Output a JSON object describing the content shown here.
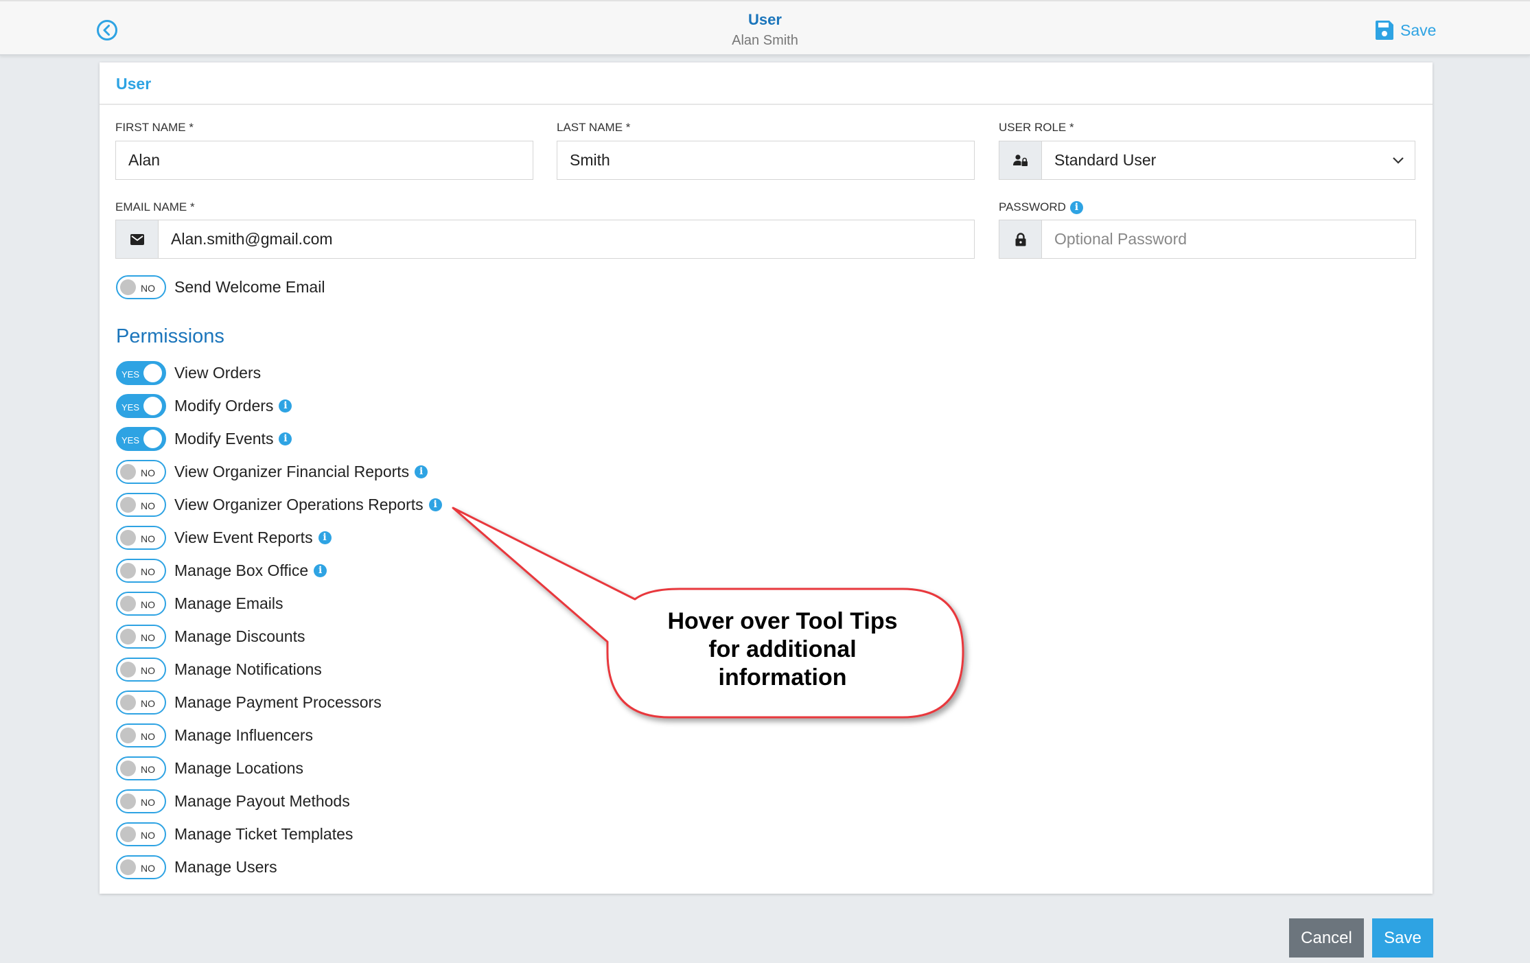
{
  "header": {
    "title": "User",
    "subtitle": "Alan Smith",
    "save_label": "Save",
    "back_icon": "chevron-circle-left-icon",
    "save_icon": "floppy-disk-icon"
  },
  "card": {
    "title": "User",
    "fields": {
      "first_name": {
        "label": "FIRST NAME *",
        "value": "Alan"
      },
      "last_name": {
        "label": "LAST NAME *",
        "value": "Smith"
      },
      "user_role": {
        "label": "USER ROLE *",
        "value": "Standard User",
        "icon": "user-lock-icon"
      },
      "email": {
        "label": "EMAIL NAME *",
        "value": "Alan.smith@gmail.com",
        "icon": "envelope-icon"
      },
      "password": {
        "label": "PASSWORD",
        "value": "",
        "placeholder": "Optional Password",
        "icon": "lock-icon",
        "has_info": true
      }
    },
    "welcome_email": {
      "label": "Send Welcome Email",
      "state": "NO"
    },
    "permissions": {
      "heading": "Permissions",
      "items": [
        {
          "label": "View Orders",
          "state": "YES",
          "info": false
        },
        {
          "label": "Modify Orders",
          "state": "YES",
          "info": true
        },
        {
          "label": "Modify Events",
          "state": "YES",
          "info": true
        },
        {
          "label": "View Organizer Financial Reports",
          "state": "NO",
          "info": true
        },
        {
          "label": "View Organizer Operations Reports",
          "state": "NO",
          "info": true
        },
        {
          "label": "View Event Reports",
          "state": "NO",
          "info": true
        },
        {
          "label": "Manage Box Office",
          "state": "NO",
          "info": true
        },
        {
          "label": "Manage Emails",
          "state": "NO",
          "info": false
        },
        {
          "label": "Manage Discounts",
          "state": "NO",
          "info": false
        },
        {
          "label": "Manage Notifications",
          "state": "NO",
          "info": false
        },
        {
          "label": "Manage Payment Processors",
          "state": "NO",
          "info": false
        },
        {
          "label": "Manage Influencers",
          "state": "NO",
          "info": false
        },
        {
          "label": "Manage Locations",
          "state": "NO",
          "info": false
        },
        {
          "label": "Manage Payout Methods",
          "state": "NO",
          "info": false
        },
        {
          "label": "Manage Ticket Templates",
          "state": "NO",
          "info": false
        },
        {
          "label": "Manage Users",
          "state": "NO",
          "info": false
        }
      ]
    }
  },
  "footer": {
    "cancel_label": "Cancel",
    "save_label": "Save"
  },
  "annotation": {
    "text_lines": [
      "Hover over Tool Tips",
      "for additional",
      "information"
    ],
    "color": "#e8383d"
  },
  "colors": {
    "accent": "#2ea3e3",
    "heading_blue": "#1b75bb",
    "cancel_gray": "#6c757d"
  },
  "info_glyph": "i"
}
